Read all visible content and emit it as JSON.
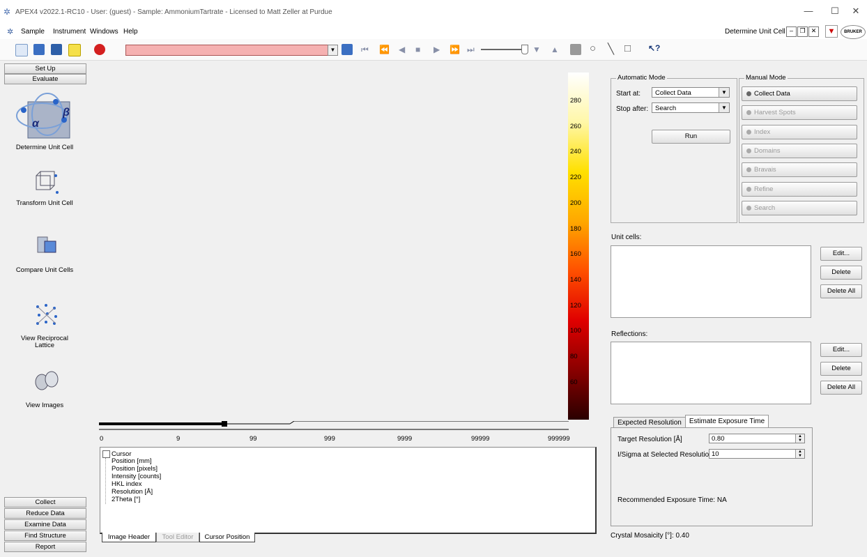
{
  "window": {
    "title": "APEX4 v2022.1-RC10 - User: (guest) - Sample: AmmoniumTartrate - Licensed to Matt Zeller at Purdue",
    "minimize": "—",
    "maximize": "☐",
    "close": "✕"
  },
  "menu": {
    "items": [
      "Sample",
      "Instrument",
      "Windows",
      "Help"
    ],
    "context_label": "Determine Unit Cell",
    "logo_text": "BRUKER"
  },
  "sidebar": {
    "top_buttons": [
      "Set Up",
      "Evaluate"
    ],
    "tools": [
      {
        "label": "Determine Unit Cell",
        "icon": "unit-cell-alpha-beta-icon"
      },
      {
        "label": "Transform Unit Cell",
        "icon": "lattice-cube-icon"
      },
      {
        "label": "Compare Unit Cells",
        "icon": "compare-boxes-icon"
      },
      {
        "label": "View Reciprocal",
        "label2": "Lattice",
        "icon": "reciprocal-lattice-icon"
      },
      {
        "label": "View Images",
        "icon": "binoculars-icon"
      }
    ],
    "bottom_buttons": [
      "Collect",
      "Reduce Data",
      "Examine Data",
      "Find Structure",
      "Report"
    ]
  },
  "colorbar": {
    "ticks": [
      "280",
      "260",
      "240",
      "220",
      "200",
      "180",
      "160",
      "140",
      "120",
      "100",
      "80",
      "60"
    ],
    "gradient": [
      "#ffffff",
      "#fff7a8",
      "#ffe000",
      "#ffa800",
      "#ff5000",
      "#e00000",
      "#8a0000",
      "#2a0000"
    ]
  },
  "ruler": {
    "labels": [
      "0",
      "9",
      "99",
      "999",
      "9999",
      "99999",
      "999999"
    ]
  },
  "cursor_panel": {
    "root": "Cursor",
    "children": [
      "Position [mm]",
      "Position [pixels]",
      "Intensity [counts]",
      "HKL index",
      "Resolution [Å]",
      "2Theta [°]"
    ]
  },
  "bottom_tabs": [
    "Image Header",
    "Tool Editor",
    "Cursor Position"
  ],
  "automatic_mode": {
    "title": "Automatic Mode",
    "start_label": "Start at:",
    "start_value": "Collect Data",
    "stop_label": "Stop after:",
    "stop_value": "Search",
    "run": "Run"
  },
  "manual_mode": {
    "title": "Manual Mode",
    "buttons": [
      "Collect Data",
      "Harvest Spots",
      "Index",
      "Domains",
      "Bravais",
      "Refine",
      "Search"
    ]
  },
  "unit_cells": {
    "label": "Unit cells:",
    "edit": "Edit...",
    "delete": "Delete",
    "delete_all": "Delete All"
  },
  "reflections": {
    "label": "Reflections:",
    "edit": "Edit...",
    "delete": "Delete",
    "delete_all": "Delete All"
  },
  "exposure": {
    "tabs": [
      "Expected Resolution",
      "Estimate  Exposure Time"
    ],
    "target_label": "Target Resolution [Å]",
    "target_value": "0.80",
    "isigma_label": "I/Sigma at Selected Resolution",
    "isigma_value": "10",
    "recommended": "Recommended Exposure Time: NA"
  },
  "mosaicity": "Crystal Mosaicity [°]: 0.40"
}
